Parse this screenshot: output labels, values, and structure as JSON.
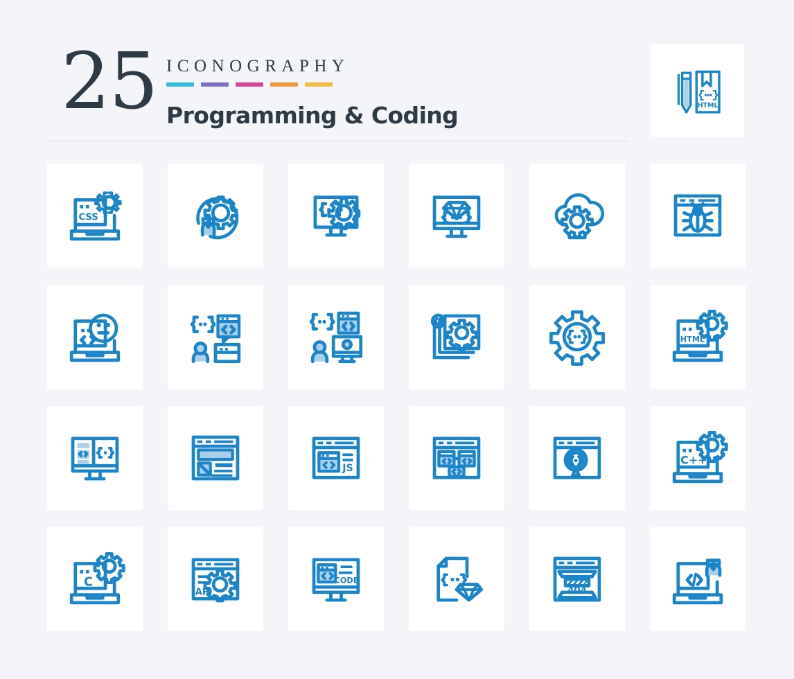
{
  "header": {
    "count": "25",
    "kicker": "ICONOGRAPHY",
    "subtitle": "Programming & Coding",
    "bar_colors": [
      "#32bde0",
      "#7a6fc4",
      "#d6459a",
      "#f1983c",
      "#f5bb44"
    ],
    "text_color": "#2e3b45",
    "divider_color": "#dfe3ea"
  },
  "palette": {
    "page_background": "#f4f5f9",
    "card_background": "#ffffff",
    "icon_primary": "#1c84c9",
    "icon_secondary": "#a9cfe9"
  },
  "featured": {
    "icon_name": "html-book-pencil-icon",
    "label": "HTML",
    "code_glyph": "{...}"
  },
  "grid": {
    "columns": 6,
    "rows": 4,
    "total": 25,
    "icons": [
      {
        "row": 1,
        "col": 1,
        "name": "css-laptop-gear-icon",
        "label": "CSS"
      },
      {
        "row": 1,
        "col": 2,
        "name": "developer-settings-icon",
        "label": ""
      },
      {
        "row": 1,
        "col": 3,
        "name": "monitor-code-gear-icon",
        "label": ""
      },
      {
        "row": 1,
        "col": 4,
        "name": "ruby-monitor-icon",
        "label": ""
      },
      {
        "row": 1,
        "col": 5,
        "name": "cloud-computing-gear-icon",
        "label": ""
      },
      {
        "row": 1,
        "col": 6,
        "name": "browser-bug-icon",
        "label": ""
      },
      {
        "row": 2,
        "col": 1,
        "name": "laptop-emoji-code-icon",
        "label": ""
      },
      {
        "row": 2,
        "col": 2,
        "name": "code-chat-user-icon",
        "label": ""
      },
      {
        "row": 2,
        "col": 3,
        "name": "user-monitor-code-icon",
        "label": ""
      },
      {
        "row": 2,
        "col": 4,
        "name": "code-files-gear-icon",
        "label": ""
      },
      {
        "row": 2,
        "col": 5,
        "name": "gear-code-brackets-icon",
        "label": ""
      },
      {
        "row": 2,
        "col": 6,
        "name": "html-laptop-gear-icon",
        "label": "HTML"
      },
      {
        "row": 3,
        "col": 1,
        "name": "split-screen-code-monitor-icon",
        "label": ""
      },
      {
        "row": 3,
        "col": 2,
        "name": "web-layout-wireframe-icon",
        "label": ""
      },
      {
        "row": 3,
        "col": 3,
        "name": "javascript-browser-icon",
        "label": "JS"
      },
      {
        "row": 3,
        "col": 4,
        "name": "code-modules-browser-icon",
        "label": ""
      },
      {
        "row": 3,
        "col": 5,
        "name": "code-search-browser-icon",
        "label": ""
      },
      {
        "row": 3,
        "col": 6,
        "name": "cplusplus-laptop-gear-icon",
        "label": "C++"
      },
      {
        "row": 4,
        "col": 1,
        "name": "c-language-laptop-gear-icon",
        "label": "C"
      },
      {
        "row": 4,
        "col": 2,
        "name": "api-browser-gear-icon",
        "label": "API"
      },
      {
        "row": 4,
        "col": 3,
        "name": "code-monitor-icon",
        "label": "CODE"
      },
      {
        "row": 4,
        "col": 4,
        "name": "ruby-file-diamond-icon",
        "label": ""
      },
      {
        "row": 4,
        "col": 5,
        "name": "error-404-browser-icon",
        "label": "404"
      },
      {
        "row": 4,
        "col": 6,
        "name": "developer-laptop-coder-icon",
        "label": ""
      }
    ]
  }
}
